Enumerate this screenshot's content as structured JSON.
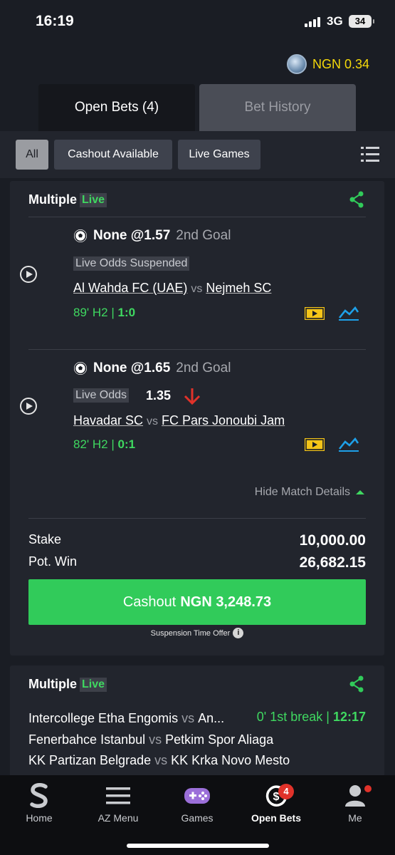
{
  "status_bar": {
    "time": "16:19",
    "network": "3G",
    "battery": "34"
  },
  "balance": {
    "text": "NGN 0.34"
  },
  "tabs": [
    {
      "label": "Open Bets (4)"
    },
    {
      "label": "Bet History"
    }
  ],
  "filters": [
    {
      "label": "All"
    },
    {
      "label": "Cashout Available"
    },
    {
      "label": "Live Games"
    }
  ],
  "bet1": {
    "title": "Multiple",
    "live_badge": "Live",
    "selections": [
      {
        "pick": "None @1.57",
        "market": "2nd Goal",
        "status": "Live Odds Suspended",
        "home": "Al Wahda FC (UAE)",
        "vs": "vs",
        "away": "Nejmeh SC",
        "clock": "89' H2 |",
        "score": "1:0"
      },
      {
        "pick": "None @1.65",
        "market": "2nd Goal",
        "status": "Live Odds",
        "current_odds": "1.35",
        "home": "Havadar SC",
        "vs": "vs",
        "away": "FC Pars Jonoubi Jam",
        "clock": "82' H2 |",
        "score": "0:1"
      }
    ],
    "hide_details": "Hide Match Details",
    "stake_label": "Stake",
    "stake_value": "10,000.00",
    "potwin_label": "Pot. Win",
    "potwin_value": "26,682.15",
    "cashout_prefix": "Cashout",
    "cashout_amount": "NGN 3,248.73",
    "offer_note": "Suspension Time Offer",
    "info_glyph": "i"
  },
  "bet2": {
    "title": "Multiple",
    "live_badge": "Live",
    "matches": [
      {
        "home": "Intercollege Etha Engomis",
        "vs": "vs",
        "away": "An..."
      },
      {
        "home": "Fenerbahce Istanbul",
        "vs": "vs",
        "away": "Petkim Spor Aliaga"
      },
      {
        "home": "KK Partizan Belgrade",
        "vs": "vs",
        "away": "KK Krka Novo Mesto"
      }
    ],
    "clock": "0' 1st break |",
    "clock_time": "12:17"
  },
  "nav": [
    {
      "label": "Home",
      "icon": "sportybet-logo-icon"
    },
    {
      "label": "AZ Menu",
      "icon": "menu-icon"
    },
    {
      "label": "Games",
      "icon": "gamepad-icon"
    },
    {
      "label": "Open Bets",
      "icon": "cashout-icon",
      "badge": "4"
    },
    {
      "label": "Me",
      "icon": "user-icon"
    }
  ],
  "colors": {
    "accent_green": "#31cb5a",
    "live_green": "#3fd860",
    "balance_yellow": "#f5d90a",
    "badge_red": "#e0322a",
    "stats_blue": "#1ea0e8",
    "tv_yellow": "#f5c518"
  }
}
